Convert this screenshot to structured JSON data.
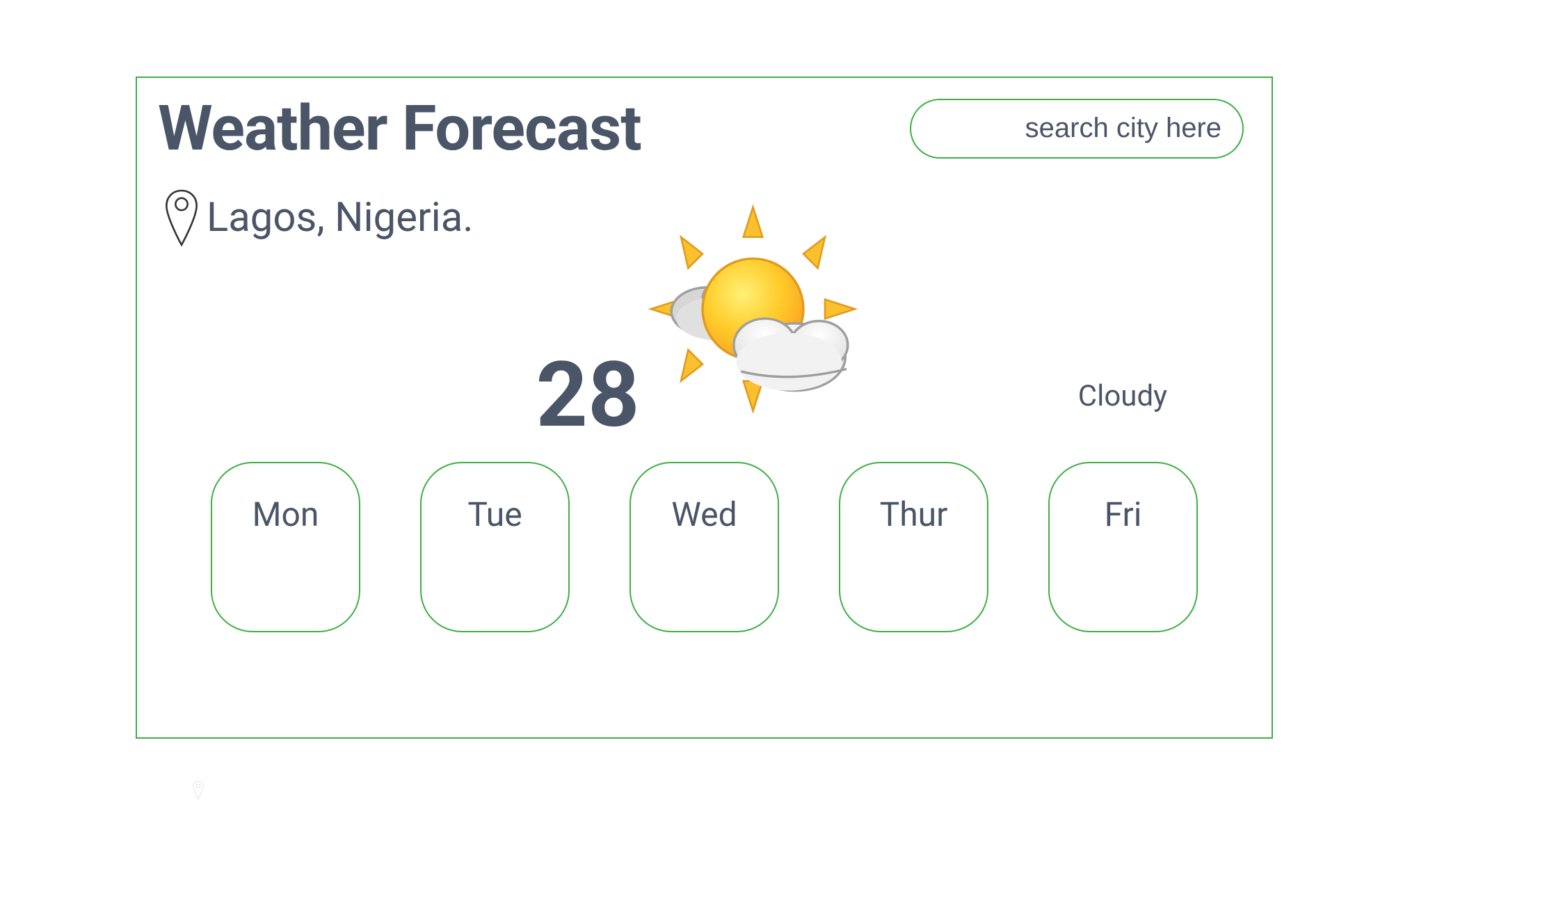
{
  "title": "Weather Forecast",
  "search": {
    "placeholder": "search city here"
  },
  "location": "Lagos, Nigeria.",
  "current": {
    "temperature": "28",
    "condition": "Cloudy"
  },
  "days": [
    {
      "label": "Mon"
    },
    {
      "label": "Tue"
    },
    {
      "label": "Wed"
    },
    {
      "label": "Thur"
    },
    {
      "label": "Fri"
    }
  ]
}
